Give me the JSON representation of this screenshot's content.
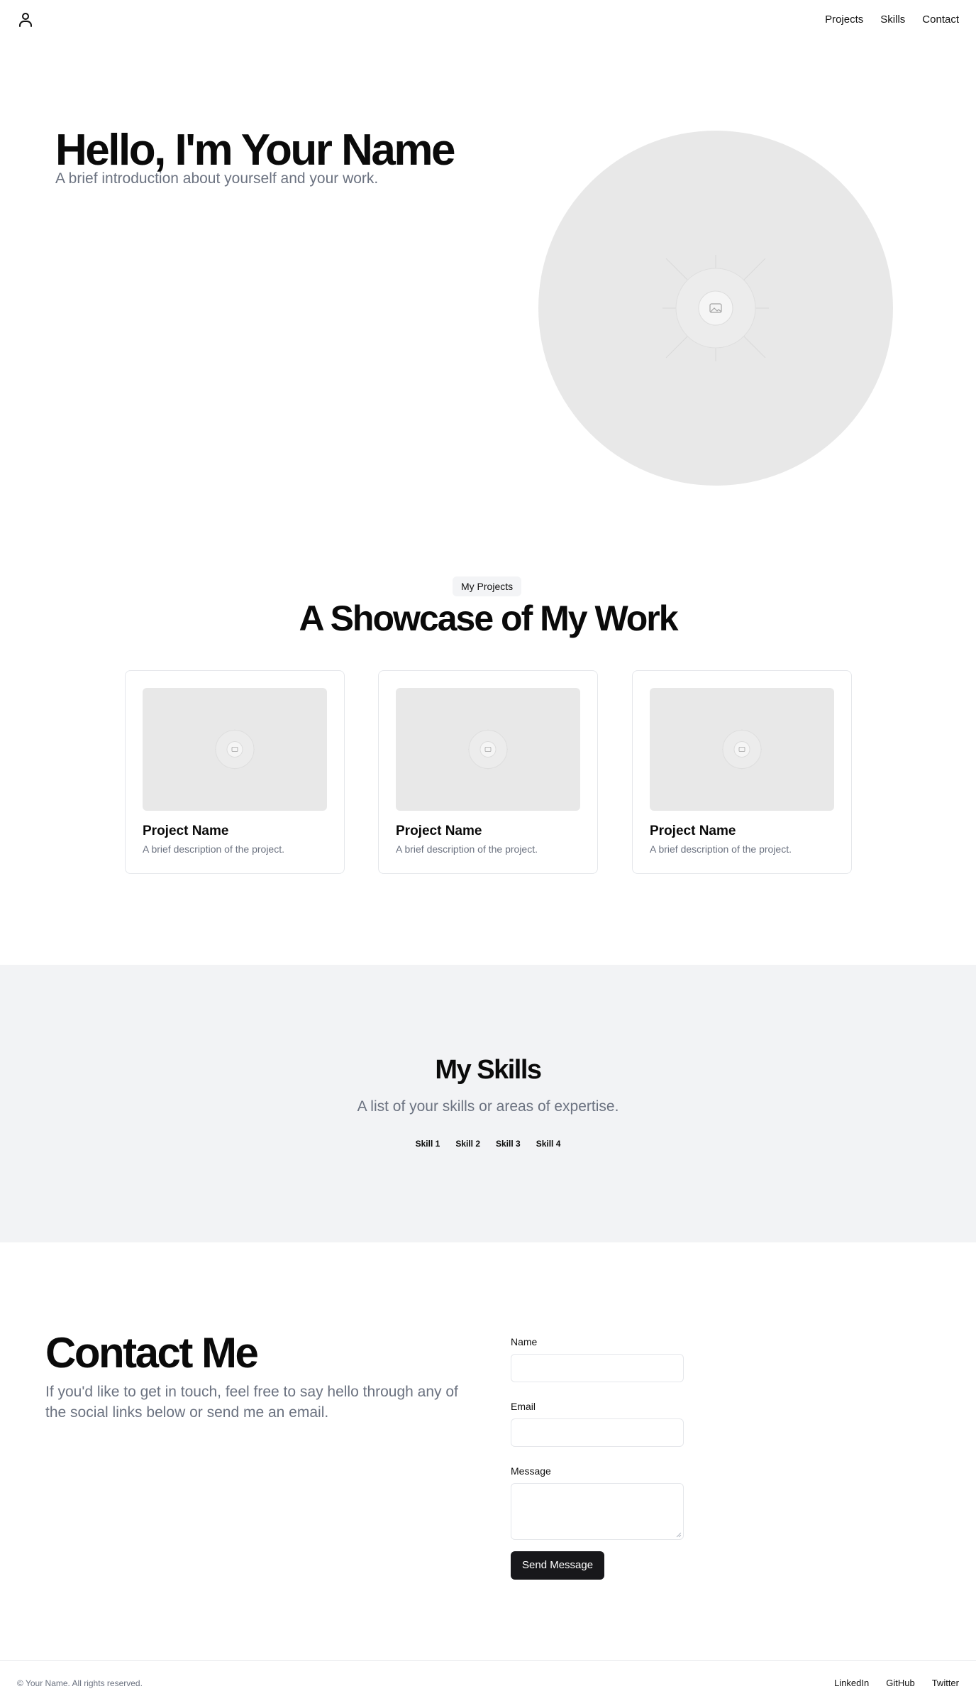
{
  "header": {
    "nav": [
      {
        "label": "Projects"
      },
      {
        "label": "Skills"
      },
      {
        "label": "Contact"
      }
    ]
  },
  "hero": {
    "title": "Hello, I'm Your Name",
    "subtitle": "A brief introduction about yourself and your work."
  },
  "projects": {
    "badge": "My Projects",
    "title": "A Showcase of My Work",
    "items": [
      {
        "name": "Project Name",
        "description": "A brief description of the project."
      },
      {
        "name": "Project Name",
        "description": "A brief description of the project."
      },
      {
        "name": "Project Name",
        "description": "A brief description of the project."
      }
    ]
  },
  "skills": {
    "title": "My Skills",
    "subtitle": "A list of your skills or areas of expertise.",
    "items": [
      "Skill 1",
      "Skill 2",
      "Skill 3",
      "Skill 4"
    ]
  },
  "contact": {
    "title": "Contact Me",
    "subtitle": "If you'd like to get in touch, feel free to say hello through any of the social links below or send me an email.",
    "form": {
      "name_label": "Name",
      "email_label": "Email",
      "message_label": "Message",
      "name_value": "",
      "email_value": "",
      "message_value": "",
      "submit_label": "Send Message"
    }
  },
  "footer": {
    "copyright": "© Your Name. All rights reserved.",
    "links": [
      "LinkedIn",
      "GitHub",
      "Twitter"
    ]
  },
  "icons": {
    "logo": "user-icon",
    "placeholder": "image-placeholder-icon"
  },
  "colors": {
    "primary_button": "#18181b",
    "muted_text": "#6b7280",
    "skills_background": "#f2f3f5",
    "placeholder_fill": "#e8e8e8"
  }
}
